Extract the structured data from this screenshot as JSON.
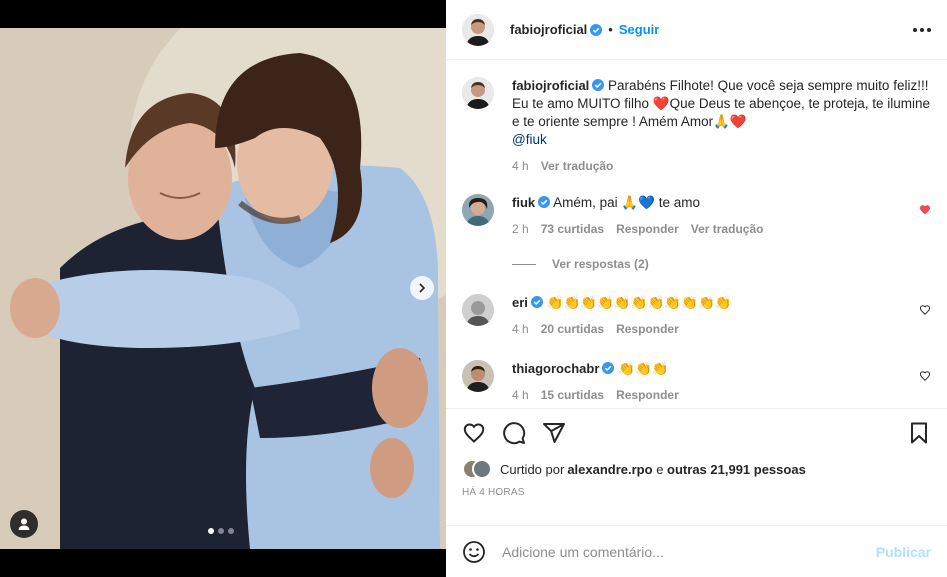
{
  "post": {
    "author": "fabiojroficial",
    "follow_label": "Seguir",
    "separator": "•",
    "carousel": {
      "slides": 3,
      "active_index": 0
    }
  },
  "caption": {
    "username": "fabiojroficial",
    "text_1": " Parabéns Filhote! Que você seja sempre muito feliz!!! Eu te amo MUITO filho ",
    "emoji_heart": "❤️",
    "text_2": "Que Deus te abençoe, te proteja, te ilumine e te oriente sempre ! Amém Amor",
    "emoji_pray": "🙏",
    "emoji_heart2": "❤️",
    "mention": "@fiuk",
    "time": "4 h",
    "translate": "Ver tradução"
  },
  "comments": [
    {
      "username": "fiuk",
      "text": " Amém, pai 🙏💙 te amo",
      "time": "2 h",
      "likes": "73 curtidas",
      "reply": "Responder",
      "translate": "Ver tradução",
      "liked": true,
      "replies_label": "Ver respostas (2)"
    },
    {
      "username": "eri",
      "text": " 👏👏👏👏👏👏👏👏👏👏👏",
      "time": "4 h",
      "likes": "20 curtidas",
      "reply": "Responder",
      "liked": false
    },
    {
      "username": "thiagorochabr",
      "text": " 👏👏👏",
      "time": "4 h",
      "likes": "15 curtidas",
      "reply": "Responder",
      "liked": false
    }
  ],
  "likes": {
    "prefix": "Curtido por ",
    "user": "alexandre.rpo",
    "middle": " e ",
    "others": "outras 21,991 pessoas"
  },
  "time_ago": "HÁ 4 HORAS",
  "add_comment": {
    "placeholder": "Adicione um comentário...",
    "post_label": "Publicar"
  },
  "colors": {
    "link_blue": "#0095f6",
    "verified_blue": "#3897f0",
    "heart_red": "#ed4956",
    "text": "#262626",
    "muted": "#8e8e8e"
  }
}
